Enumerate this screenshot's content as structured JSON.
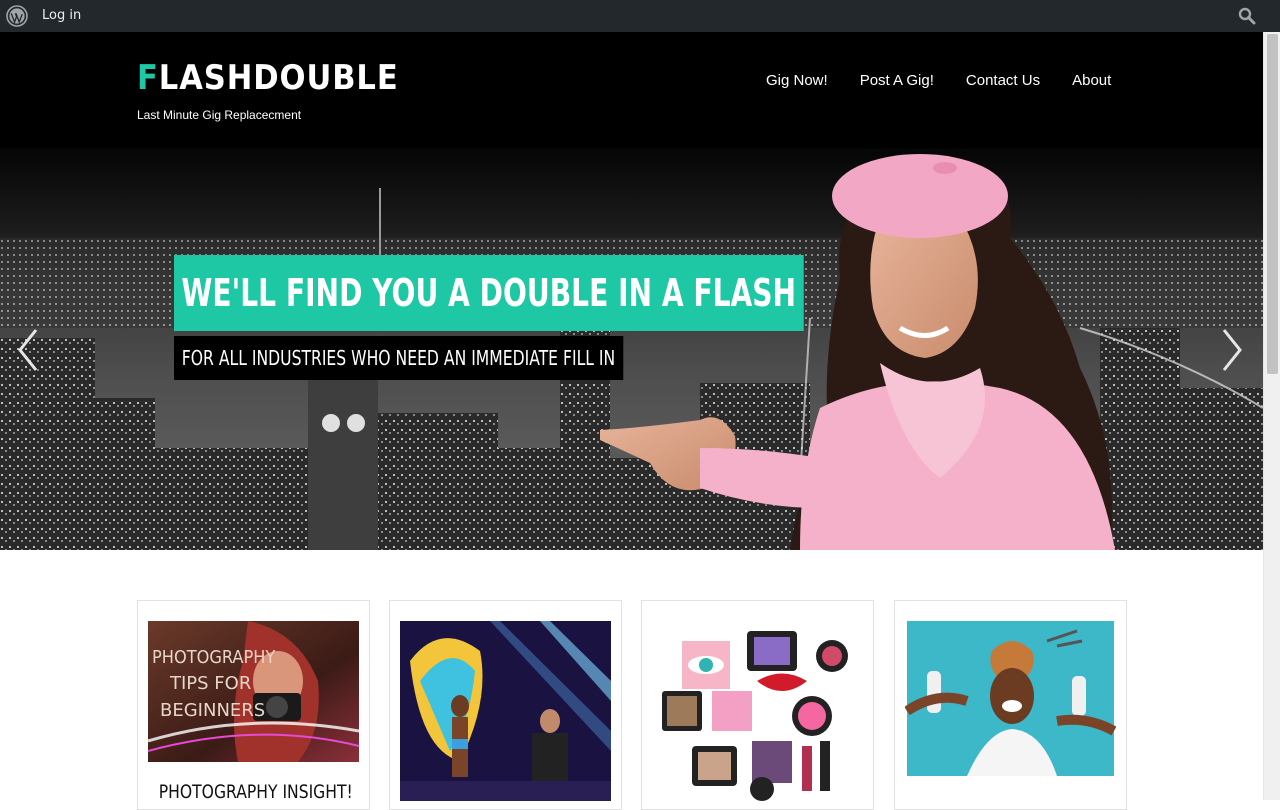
{
  "adminbar": {
    "login_label": "Log in",
    "wp_icon": "wordpress-icon",
    "search_icon": "search-icon"
  },
  "header": {
    "title_first": "F",
    "title_rest": "LASHDOUBLE",
    "tagline": "Last Minute Gig Replacecment",
    "nav": [
      "Gig Now!",
      "Post A Gig!",
      "Contact Us",
      "About"
    ]
  },
  "hero": {
    "headline": "WE'LL FIND YOU A DOUBLE IN A FLASH",
    "subheadline": "FOR ALL INDUSTRIES WHO NEED AN IMMEDIATE FILL IN",
    "prev_icon": "chevron-left-icon",
    "next_icon": "chevron-right-icon"
  },
  "cards": [
    {
      "image_text": [
        "PHOTOGRAPHY",
        "TIPS FOR",
        "BEGINNERS"
      ],
      "title": "PHOTOGRAPHY INSIGHT!"
    },
    {
      "title": ""
    },
    {
      "title": ""
    },
    {
      "title": ""
    }
  ],
  "colors": {
    "accent": "#1ec8a5",
    "adminbar": "#23282d",
    "header": "#000000"
  }
}
